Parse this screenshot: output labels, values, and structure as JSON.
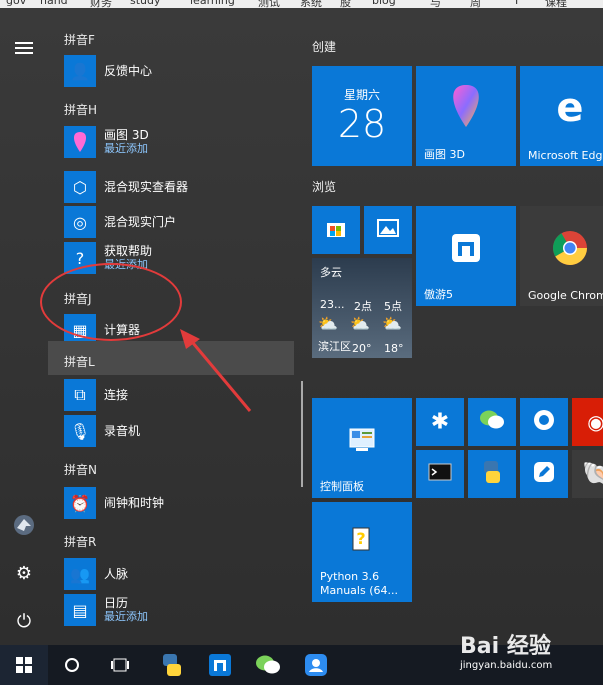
{
  "bookmarks": [
    "gov",
    "hand",
    "财务",
    "study",
    "learning",
    "测试",
    "系统",
    "股",
    "blog",
    "与",
    "周",
    "I",
    "课程"
  ],
  "rail": {
    "menu_icon": "hamburger-icon",
    "user_icon": "avatar",
    "settings_icon": "gear-icon",
    "power_icon": "power-icon"
  },
  "applist": {
    "groups": [
      {
        "header": "拼音F",
        "items": [
          {
            "name": "反馈中心",
            "sub": ""
          }
        ]
      },
      {
        "header": "拼音H",
        "items": [
          {
            "name": "画图 3D",
            "sub": "最近添加"
          },
          {
            "name": "混合现实查看器",
            "sub": ""
          },
          {
            "name": "混合现实门户",
            "sub": ""
          },
          {
            "name": "获取帮助",
            "sub": "最近添加"
          }
        ]
      },
      {
        "header": "拼音J",
        "items": [
          {
            "name": "计算器",
            "sub": ""
          }
        ]
      },
      {
        "header": "拼音L",
        "items": [
          {
            "name": "连接",
            "sub": ""
          },
          {
            "name": "录音机",
            "sub": ""
          }
        ]
      },
      {
        "header": "拼音N",
        "items": [
          {
            "name": "闹钟和时钟",
            "sub": ""
          }
        ]
      },
      {
        "header": "拼音R",
        "items": [
          {
            "name": "人脉",
            "sub": ""
          },
          {
            "name": "日历",
            "sub": "最近添加"
          }
        ]
      }
    ]
  },
  "tiles": {
    "group1_title": "创建",
    "group2_title": "浏览",
    "calendar": {
      "weekday": "星期六",
      "day": "28"
    },
    "paint3d": "画图 3D",
    "edge": "Microsoft Edge",
    "maxthon": "傲游5",
    "chrome": "Google Chrome",
    "weather": {
      "condition": "多云",
      "times": [
        "23...",
        "2点",
        "5点"
      ],
      "temps": [
        "20°",
        "18°"
      ],
      "location": "滨江区"
    },
    "control_panel": "控制面板",
    "python": "Python 3.6 Manuals (64..."
  },
  "watermark": {
    "main": "Bai 经验",
    "sub": "jingyan.baidu.com"
  },
  "colors": {
    "tile_blue": "#0a78d7",
    "highlight": "#e23b3b",
    "taskbar": "#151a22"
  }
}
